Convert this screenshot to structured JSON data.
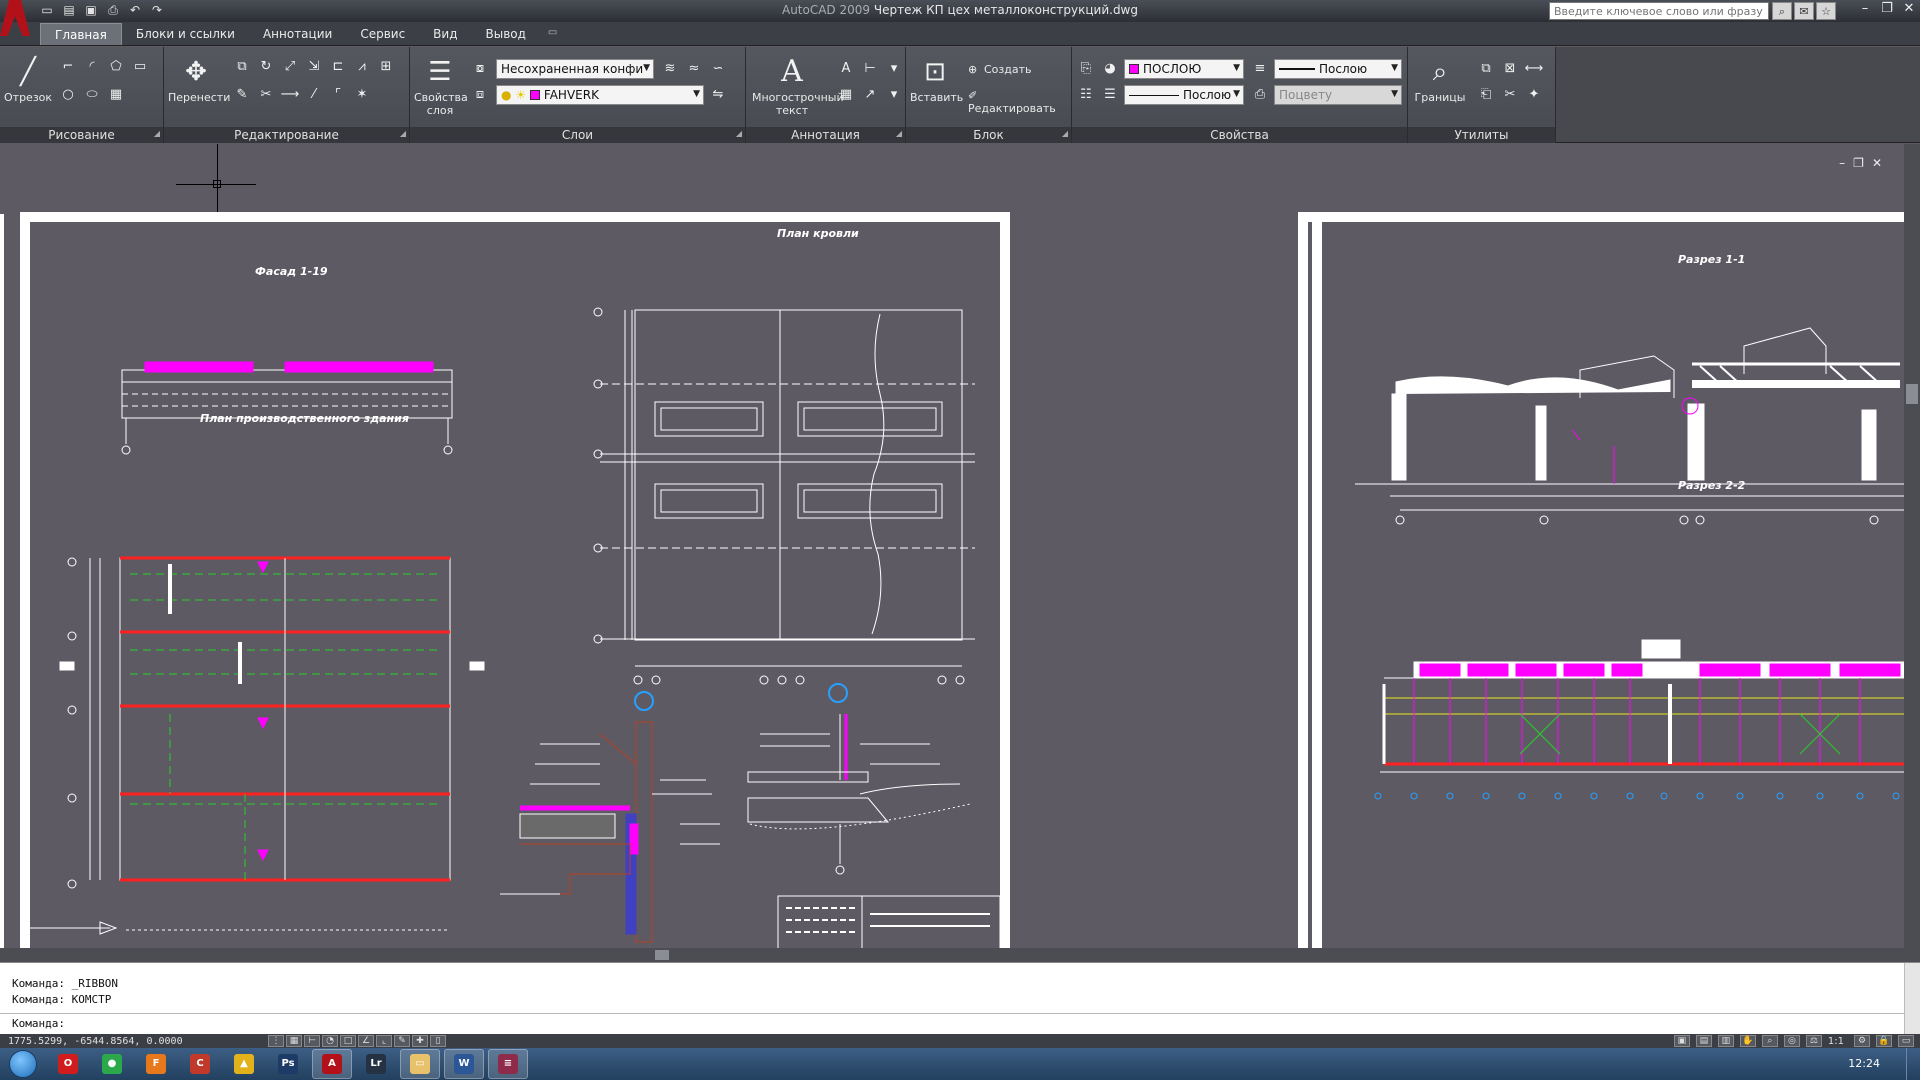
{
  "window": {
    "app_name": "AutoCAD 2009",
    "file_name": "Чертеж КП цех металлоконструкций.dwg",
    "search_placeholder": "Введите ключевое слово или фразу"
  },
  "tabs": [
    "Главная",
    "Блоки и ссылки",
    "Аннотации",
    "Сервис",
    "Вид",
    "Вывод"
  ],
  "ribbon": {
    "draw": {
      "title": "Рисование",
      "line_label": "Отрезок"
    },
    "modify": {
      "title": "Редактирование",
      "move_label": "Перенести"
    },
    "layers": {
      "title": "Слои",
      "properties_label": "Свойства слоя",
      "state_combo": "Несохраненная конфи",
      "layer_combo": "FAHVERK"
    },
    "annotation": {
      "title": "Аннотация",
      "mtext_label": "Многострочный текст"
    },
    "block": {
      "title": "Блок",
      "insert_label": "Вставить",
      "create_label": "Создать",
      "edit_label": "Редактировать"
    },
    "properties": {
      "title": "Свойства",
      "color_combo": "ПОСЛОЮ",
      "lineweight_combo": "Послою",
      "linetype_combo": "Послою",
      "plotstyle_combo": "Поцвету"
    },
    "utilities": {
      "title": "Утилиты",
      "extents_label": "Границы"
    }
  },
  "drawings": {
    "facade": "Фасад 1-19",
    "plan": "План производственного здания",
    "roof": "План кровли",
    "section11": "Разрез 1-1",
    "section22": "Разрез 2-2"
  },
  "command": {
    "history": [
      "Команда:  _RIBBON",
      "Команда:  КОМСТР"
    ],
    "prompt": "Команда:"
  },
  "status": {
    "coords": "1775.5299, -6544.8564, 0.0000",
    "scale": "1:1"
  },
  "taskbar": {
    "time": "12:24",
    "apps": [
      {
        "name": "opera",
        "color": "#d01c1c",
        "glyph": "O"
      },
      {
        "name": "browser-green",
        "color": "#2aa84a",
        "glyph": "●"
      },
      {
        "name": "firefox",
        "color": "#e8781c",
        "glyph": "F"
      },
      {
        "name": "ccleaner",
        "color": "#c0392b",
        "glyph": "C"
      },
      {
        "name": "triangle-app",
        "color": "#e2b21a",
        "glyph": "▲"
      },
      {
        "name": "photoshop",
        "color": "#1d3b66",
        "glyph": "Ps"
      },
      {
        "name": "autocad",
        "color": "#b3111a",
        "glyph": "A"
      },
      {
        "name": "lightroom",
        "color": "#243244",
        "glyph": "Lr"
      },
      {
        "name": "explorer",
        "color": "#e8c26a",
        "glyph": "▭"
      },
      {
        "name": "word",
        "color": "#2b5797",
        "glyph": "W"
      },
      {
        "name": "winrar",
        "color": "#8e2a4a",
        "glyph": "≡"
      }
    ]
  },
  "colors": {
    "accent": "#b3111a",
    "canvas_bg": "#5d5a64",
    "magenta": "#ff00ff",
    "red": "#ff2020"
  }
}
